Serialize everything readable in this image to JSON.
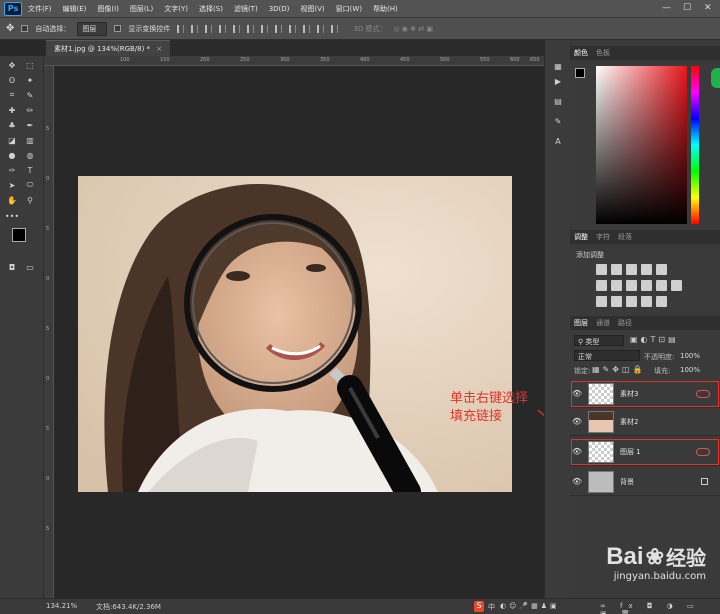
{
  "app": {
    "logo": "Ps"
  },
  "menu": [
    "文件(F)",
    "编辑(E)",
    "图像(I)",
    "图层(L)",
    "文字(Y)",
    "选择(S)",
    "滤镜(T)",
    "3D(D)",
    "视图(V)",
    "窗口(W)",
    "帮助(H)"
  ],
  "window_controls": {
    "minimize": "—",
    "maximize": "☐",
    "close": "✕"
  },
  "options": {
    "auto_select_label": "自动选择：",
    "auto_select_value": "图层",
    "show_transform_label": "显示变换控件",
    "mode_3d_label": "3D 模式："
  },
  "document": {
    "tab_title": "素材1.jpg @ 134%(RGB/8) *",
    "zoom": "134.21%",
    "doc_info": "文档:643.4K/2.36M"
  },
  "ruler_ticks": [
    "100",
    "150",
    "200",
    "250",
    "300",
    "350",
    "400",
    "450",
    "500",
    "550",
    "600",
    "650"
  ],
  "v_ruler_ticks": [
    "5",
    "0",
    "5",
    "0",
    "5",
    "0",
    "5",
    "0",
    "5"
  ],
  "panels": {
    "color_tabs": [
      "颜色",
      "色板"
    ],
    "adjust_tabs": [
      "调整",
      "字符",
      "段落"
    ],
    "adjust_title": "添加调整",
    "layers_tabs": [
      "图层",
      "通道",
      "路径"
    ],
    "filter_kind": "类型",
    "blend_mode": "正常",
    "opacity_label": "不透明度:",
    "opacity_value": "100%",
    "lock_label": "锁定:",
    "fill_label": "填充:",
    "fill_value": "100%"
  },
  "layers": [
    {
      "name": "素材3",
      "linked": true
    },
    {
      "name": "素材2",
      "linked": false
    },
    {
      "name": "图层 1",
      "linked": true
    },
    {
      "name": "背景",
      "locked": true
    }
  ],
  "annotation": {
    "line1": "单击右键选择",
    "line2": "填充链接",
    "color": "#e0352b"
  },
  "watermark": {
    "brand": "Bai",
    "brand2": "经验",
    "url": "jingyan.baidu.com"
  },
  "ime": {
    "label": "中"
  },
  "colors": {
    "accent": "#31a8ff",
    "annotation": "#e0352b",
    "panel_bg": "#3a3a3a"
  }
}
